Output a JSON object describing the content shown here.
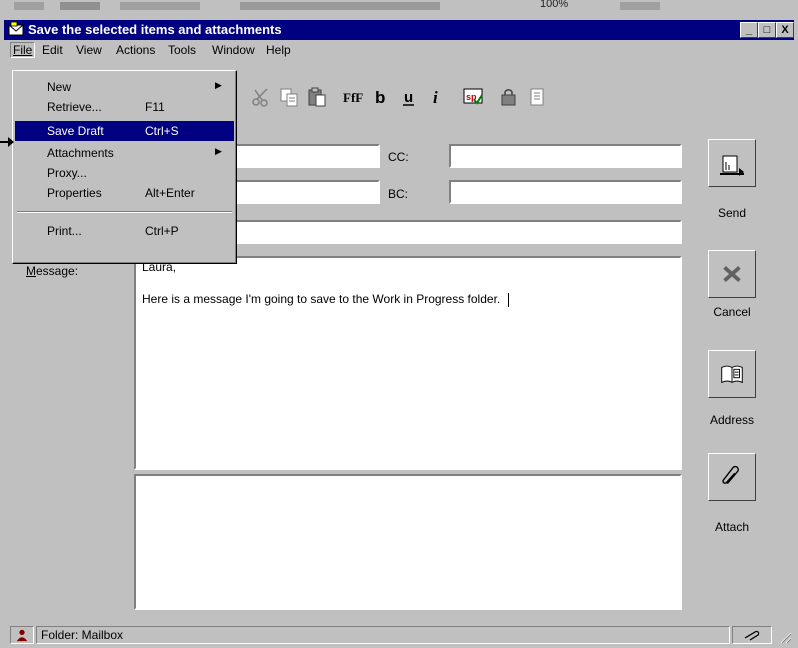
{
  "window": {
    "title": "Save the selected items and attachments",
    "zoom_text": "100%",
    "controls": [
      "_",
      "□",
      "X"
    ]
  },
  "menubar": {
    "items": [
      {
        "label": "File"
      },
      {
        "label": "Edit"
      },
      {
        "label": "View"
      },
      {
        "label": "Actions"
      },
      {
        "label": "Tools"
      },
      {
        "label": "Window"
      },
      {
        "label": "Help"
      }
    ]
  },
  "file_menu": {
    "items": [
      {
        "label": "New",
        "shortcut": "",
        "submenu": true
      },
      {
        "label": "Retrieve...",
        "shortcut": "F11",
        "submenu": false
      },
      {
        "label": "Save Draft",
        "shortcut": "Ctrl+S",
        "submenu": false,
        "highlighted": true
      },
      {
        "label": "Attachments",
        "shortcut": "",
        "submenu": true
      },
      {
        "label": "Proxy...",
        "shortcut": "",
        "submenu": false
      },
      {
        "label": "Properties",
        "shortcut": "Alt+Enter",
        "submenu": false
      },
      {
        "label": "Print...",
        "shortcut": "Ctrl+P",
        "submenu": false
      }
    ]
  },
  "form": {
    "cc_label": "CC:",
    "bc_label": "BC:",
    "message_label": "Message:",
    "to_value": "",
    "cc_value": "",
    "bc_value": "",
    "subject_value": "",
    "message_greeting": "Laura,",
    "message_body": "Here is a message I'm going to save to the Work in Progress folder."
  },
  "side_buttons": {
    "send": "Send",
    "cancel": "Cancel",
    "address": "Address",
    "attach": "Attach"
  },
  "status": {
    "folder": "Folder: Mailbox"
  },
  "colors": {
    "titlebar": "#000080",
    "face": "#c0c0c0",
    "highlight": "#000080"
  }
}
